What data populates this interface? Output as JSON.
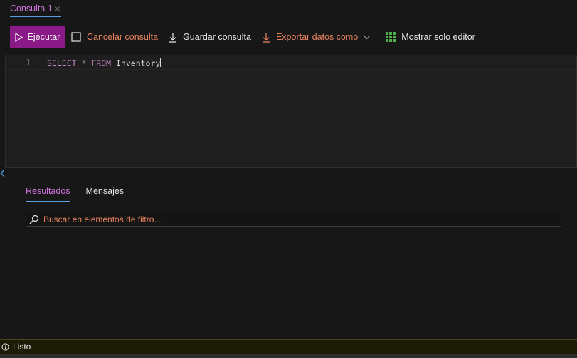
{
  "tab": {
    "label": "Consulta 1",
    "close": "×"
  },
  "toolbar": {
    "run_label": "Ejecutar",
    "cancel_label": "Cancelar consulta",
    "save_label": "Guardar consulta",
    "export_label": "Exportar datos como",
    "editor_only_label": "Mostrar solo editor",
    "icons": [
      "play-icon",
      "stop-square-icon",
      "download-icon",
      "export-arrow-icon",
      "chevron-down-icon",
      "grid-icon"
    ]
  },
  "editor": {
    "line_number": "1",
    "tokens": {
      "select": "SELECT",
      "star": "*",
      "from": "FROM",
      "table": "Inventory"
    }
  },
  "results": {
    "tabs": [
      {
        "label": "Resultados",
        "active": true
      },
      {
        "label": "Mensajes",
        "active": false
      }
    ],
    "search_placeholder": "Buscar en elementos de filtro..."
  },
  "status": {
    "text": "Listo",
    "icon": "info-icon"
  },
  "colors": {
    "accent_pink": "#d173e0",
    "run_button": "#8a1a88",
    "underline_blue": "#5aa0e6",
    "orange_text": "#e8835e",
    "grid_green": "#4fb04a",
    "status_bg": "#1c1b05"
  }
}
